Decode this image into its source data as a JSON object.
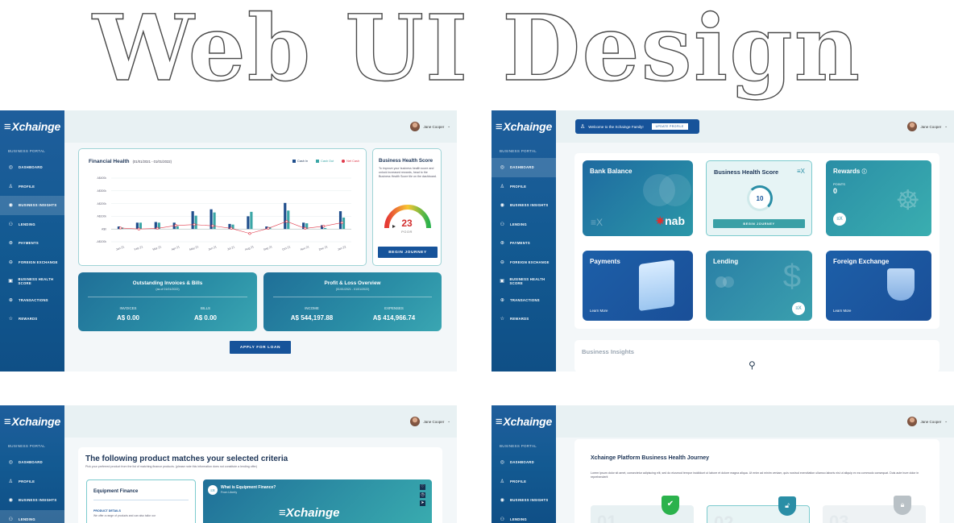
{
  "hero_title": "Web UI Design",
  "brand": {
    "logo": "Xchainge",
    "portal_label": "BUSINESS PORTAL"
  },
  "user": {
    "name": "Jane Cooper"
  },
  "nav": {
    "dashboard": "DASHBOARD",
    "profile": "PROFILE",
    "business_insights": "BUSINESS INSIGHTS",
    "lending": "LENDING",
    "payments": "PAYMENTS",
    "foreign_exchange": "FOREIGN EXCHANGE",
    "business_health_score": "BUSINESS HEALTH SCORE",
    "transactions": "TRANSACTIONS",
    "rewards": "REWARDS"
  },
  "screen1": {
    "chart_title": "Financial Health",
    "chart_range": "(01/01/2021 - 01/01/2022)",
    "legend": {
      "cash_in": "Cash In",
      "cash_out": "Cash Out",
      "net_cash": "Net Cash"
    },
    "bhs_title": "Business Health Score",
    "bhs_text": "To improve your business health score and unlock increased rewards, head to the Business Health Score tile on the dashboard.",
    "score": "23",
    "score_label": "POOR",
    "begin_journey": "BEGIN JOURNEY",
    "invoices_card": {
      "title": "Outstanding Invoices & Bills",
      "subtitle": "(as of 01/01/2022)",
      "left_label": "INVOICES",
      "left_value": "A$ 0.00",
      "right_label": "BILLS",
      "right_value": "A$ 0.00"
    },
    "pl_card": {
      "title": "Profit & Loss Overview",
      "subtitle": "(01/01/2021 - 01/01/2022)",
      "left_label": "INCOME",
      "left_value": "A$ 544,197.88",
      "right_label": "EXPENSES",
      "right_value": "A$ 414,966.74"
    },
    "apply": "APPLY FOR LOAN"
  },
  "chart_data": {
    "type": "bar",
    "title": "Financial Health",
    "subtitle": "(01/01/2021 - 01/01/2022)",
    "categories": [
      "Jan 21",
      "Feb 21",
      "Mar 21",
      "Apr 21",
      "May 21",
      "Jun 21",
      "Jul 21",
      "Aug 21",
      "Sep 21",
      "Oct 21",
      "Nov 21",
      "Dec 21",
      "Jan 22"
    ],
    "y_ticks": [
      "A$400k",
      "A$300k",
      "A$200k",
      "A$100k",
      "A$0",
      "-A$100k"
    ],
    "ylim": [
      -100,
      400
    ],
    "legend_position": "top-right",
    "grid": true,
    "series": [
      {
        "name": "Cash In",
        "type": "bar",
        "color": "#1f4e8c",
        "values": [
          20,
          50,
          55,
          50,
          140,
          155,
          40,
          100,
          20,
          205,
          50,
          30,
          140
        ]
      },
      {
        "name": "Cash Out",
        "type": "bar",
        "color": "#3aa6a6",
        "values": [
          12,
          50,
          50,
          22,
          105,
          130,
          35,
          135,
          15,
          145,
          45,
          8,
          90
        ]
      },
      {
        "name": "Net Cash",
        "type": "line",
        "color": "#e0394a",
        "values": [
          8,
          0,
          5,
          28,
          35,
          25,
          5,
          -35,
          5,
          60,
          5,
          22,
          50
        ]
      }
    ]
  },
  "screen2": {
    "welcome": "Welcome to the Xchainge Family!",
    "update_profile": "UPDATE PROFILE",
    "bank_balance": "Bank Balance",
    "nab": "nab",
    "bhs_title": "Business Health Score",
    "bhs_score": "10",
    "begin_journey": "BEGIN JOURNEY",
    "rewards": "Rewards",
    "points_label": "POINTS",
    "points": "0",
    "payments": "Payments",
    "learn_more": "Learn More",
    "lending": "Lending",
    "foreign_exchange": "Foreign Exchange",
    "insights": "Business Insights"
  },
  "screen3": {
    "heading": "The following product matches your selected criteria",
    "sub": "Pick your preferred product from the list of matching finance products. (please note this information does not constitute a lending offer)",
    "product": "Equipment Finance",
    "details_label": "PRODUCT DETAILS",
    "details_text": "We offer a range of products and can also tailor our",
    "video_title": "What is Equipment Finance?",
    "video_sub": "From Liberty",
    "video_logo": "Xchainge"
  },
  "screen4": {
    "title": "Xchainge Platform Business Health Journey",
    "para": "Lorem ipsum dolor sit amet, consectetur adipiscing elit, sed do eiusmod tempor incididunt ut labore et dolore magna aliqua. Ut enim ad minim veniam, quis nostrud exercitation ullamco laboris nisi ut aliquip ex ea commodo consequat. Duis aute irure dolor in reprehenderit",
    "steps": [
      "01",
      "02",
      "03"
    ]
  },
  "colors": {
    "sidebar": "#135a92",
    "accent_teal": "#2a8ea6",
    "primary_btn": "#16539a",
    "net_cash": "#e0394a"
  }
}
